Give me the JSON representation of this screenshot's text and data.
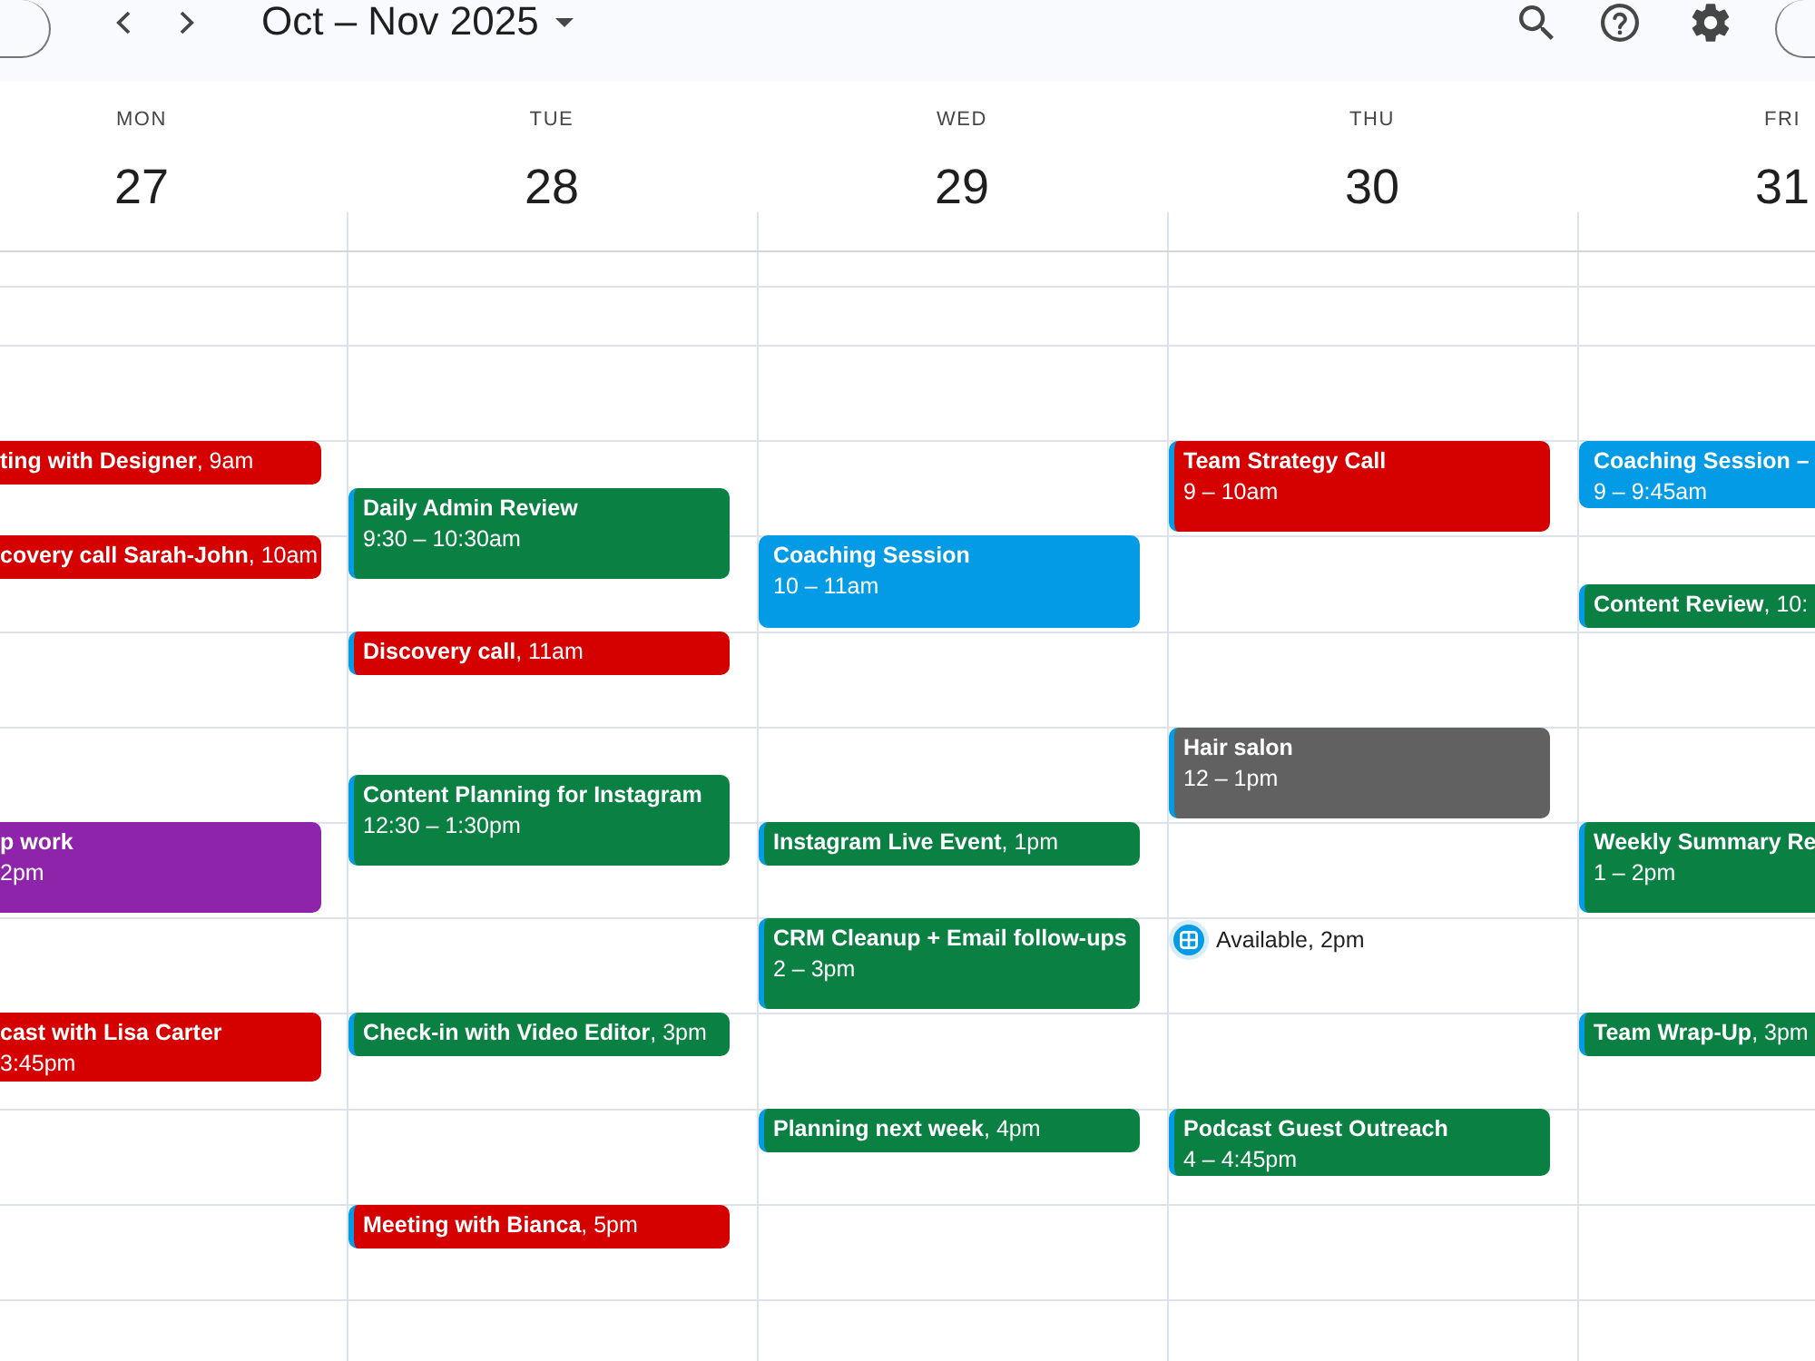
{
  "toolbar": {
    "title": "Oct – Nov 2025"
  },
  "days": [
    {
      "name": "MON",
      "date": "27",
      "events": [
        {
          "kind": "compact",
          "text": "**ting with Designer**, 9am",
          "color": "#d50000"
        },
        {
          "kind": "compact",
          "text": "**covery call Sarah-John**, 10am",
          "color": "#d50000"
        },
        {
          "kind": "full",
          "title": "p work",
          "time": "2pm",
          "color": "#8e24aa"
        },
        {
          "kind": "full",
          "title": "cast with Lisa Carter",
          "time": "3:45pm",
          "color": "#d50000"
        }
      ]
    },
    {
      "name": "TUE",
      "date": "28",
      "events": [
        {
          "kind": "full",
          "title": "Daily Admin Review",
          "time": "9:30 – 10:30am",
          "color": "#0b8043"
        },
        {
          "kind": "compact",
          "text": "**Discovery call**, 11am",
          "color": "#d50000"
        },
        {
          "kind": "full",
          "title": "Content Planning for Instagram",
          "time": "12:30 – 1:30pm",
          "color": "#0b8043"
        },
        {
          "kind": "compact",
          "text": "**Check-in with Video Editor**, 3pm",
          "color": "#0b8043"
        },
        {
          "kind": "compact",
          "text": "**Meeting with Bianca**, 5pm",
          "color": "#d50000"
        }
      ]
    },
    {
      "name": "WED",
      "date": "29",
      "events": [
        {
          "kind": "full",
          "title": "Coaching Session",
          "time": "10 – 11am",
          "color": "#039be5"
        },
        {
          "kind": "compact",
          "text": "**Instagram Live Event**, 1pm",
          "color": "#0b8043"
        },
        {
          "kind": "full",
          "title": "CRM Cleanup + Email follow-ups",
          "time": "2 – 3pm",
          "color": "#0b8043"
        },
        {
          "kind": "compact",
          "text": "**Planning next week**, 4pm",
          "color": "#0b8043"
        }
      ]
    },
    {
      "name": "THU",
      "date": "30",
      "events": [
        {
          "kind": "full",
          "title": "Team Strategy Call",
          "time": "9 – 10am",
          "color": "#d50000"
        },
        {
          "kind": "full",
          "title": "Hair salon",
          "time": "12 – 1pm",
          "color": "#616161"
        },
        {
          "kind": "appointment",
          "text": "Available, 2pm"
        },
        {
          "kind": "full",
          "title": "Podcast Guest Outreach",
          "time": "4 – 4:45pm",
          "color": "#0b8043"
        }
      ]
    },
    {
      "name": "FRI",
      "date": "31",
      "events": [
        {
          "kind": "full",
          "title": "Coaching Session –",
          "time": "9 – 9:45am",
          "color": "#039be5"
        },
        {
          "kind": "compact",
          "text": "**Content Review**, 10:",
          "color": "#0b8043"
        },
        {
          "kind": "full",
          "title": "Weekly Summary Re",
          "time": "1 – 2pm",
          "color": "#0b8043"
        },
        {
          "kind": "compact",
          "text": "**Team Wrap-Up**, 3pm",
          "color": "#0b8043"
        }
      ]
    }
  ]
}
